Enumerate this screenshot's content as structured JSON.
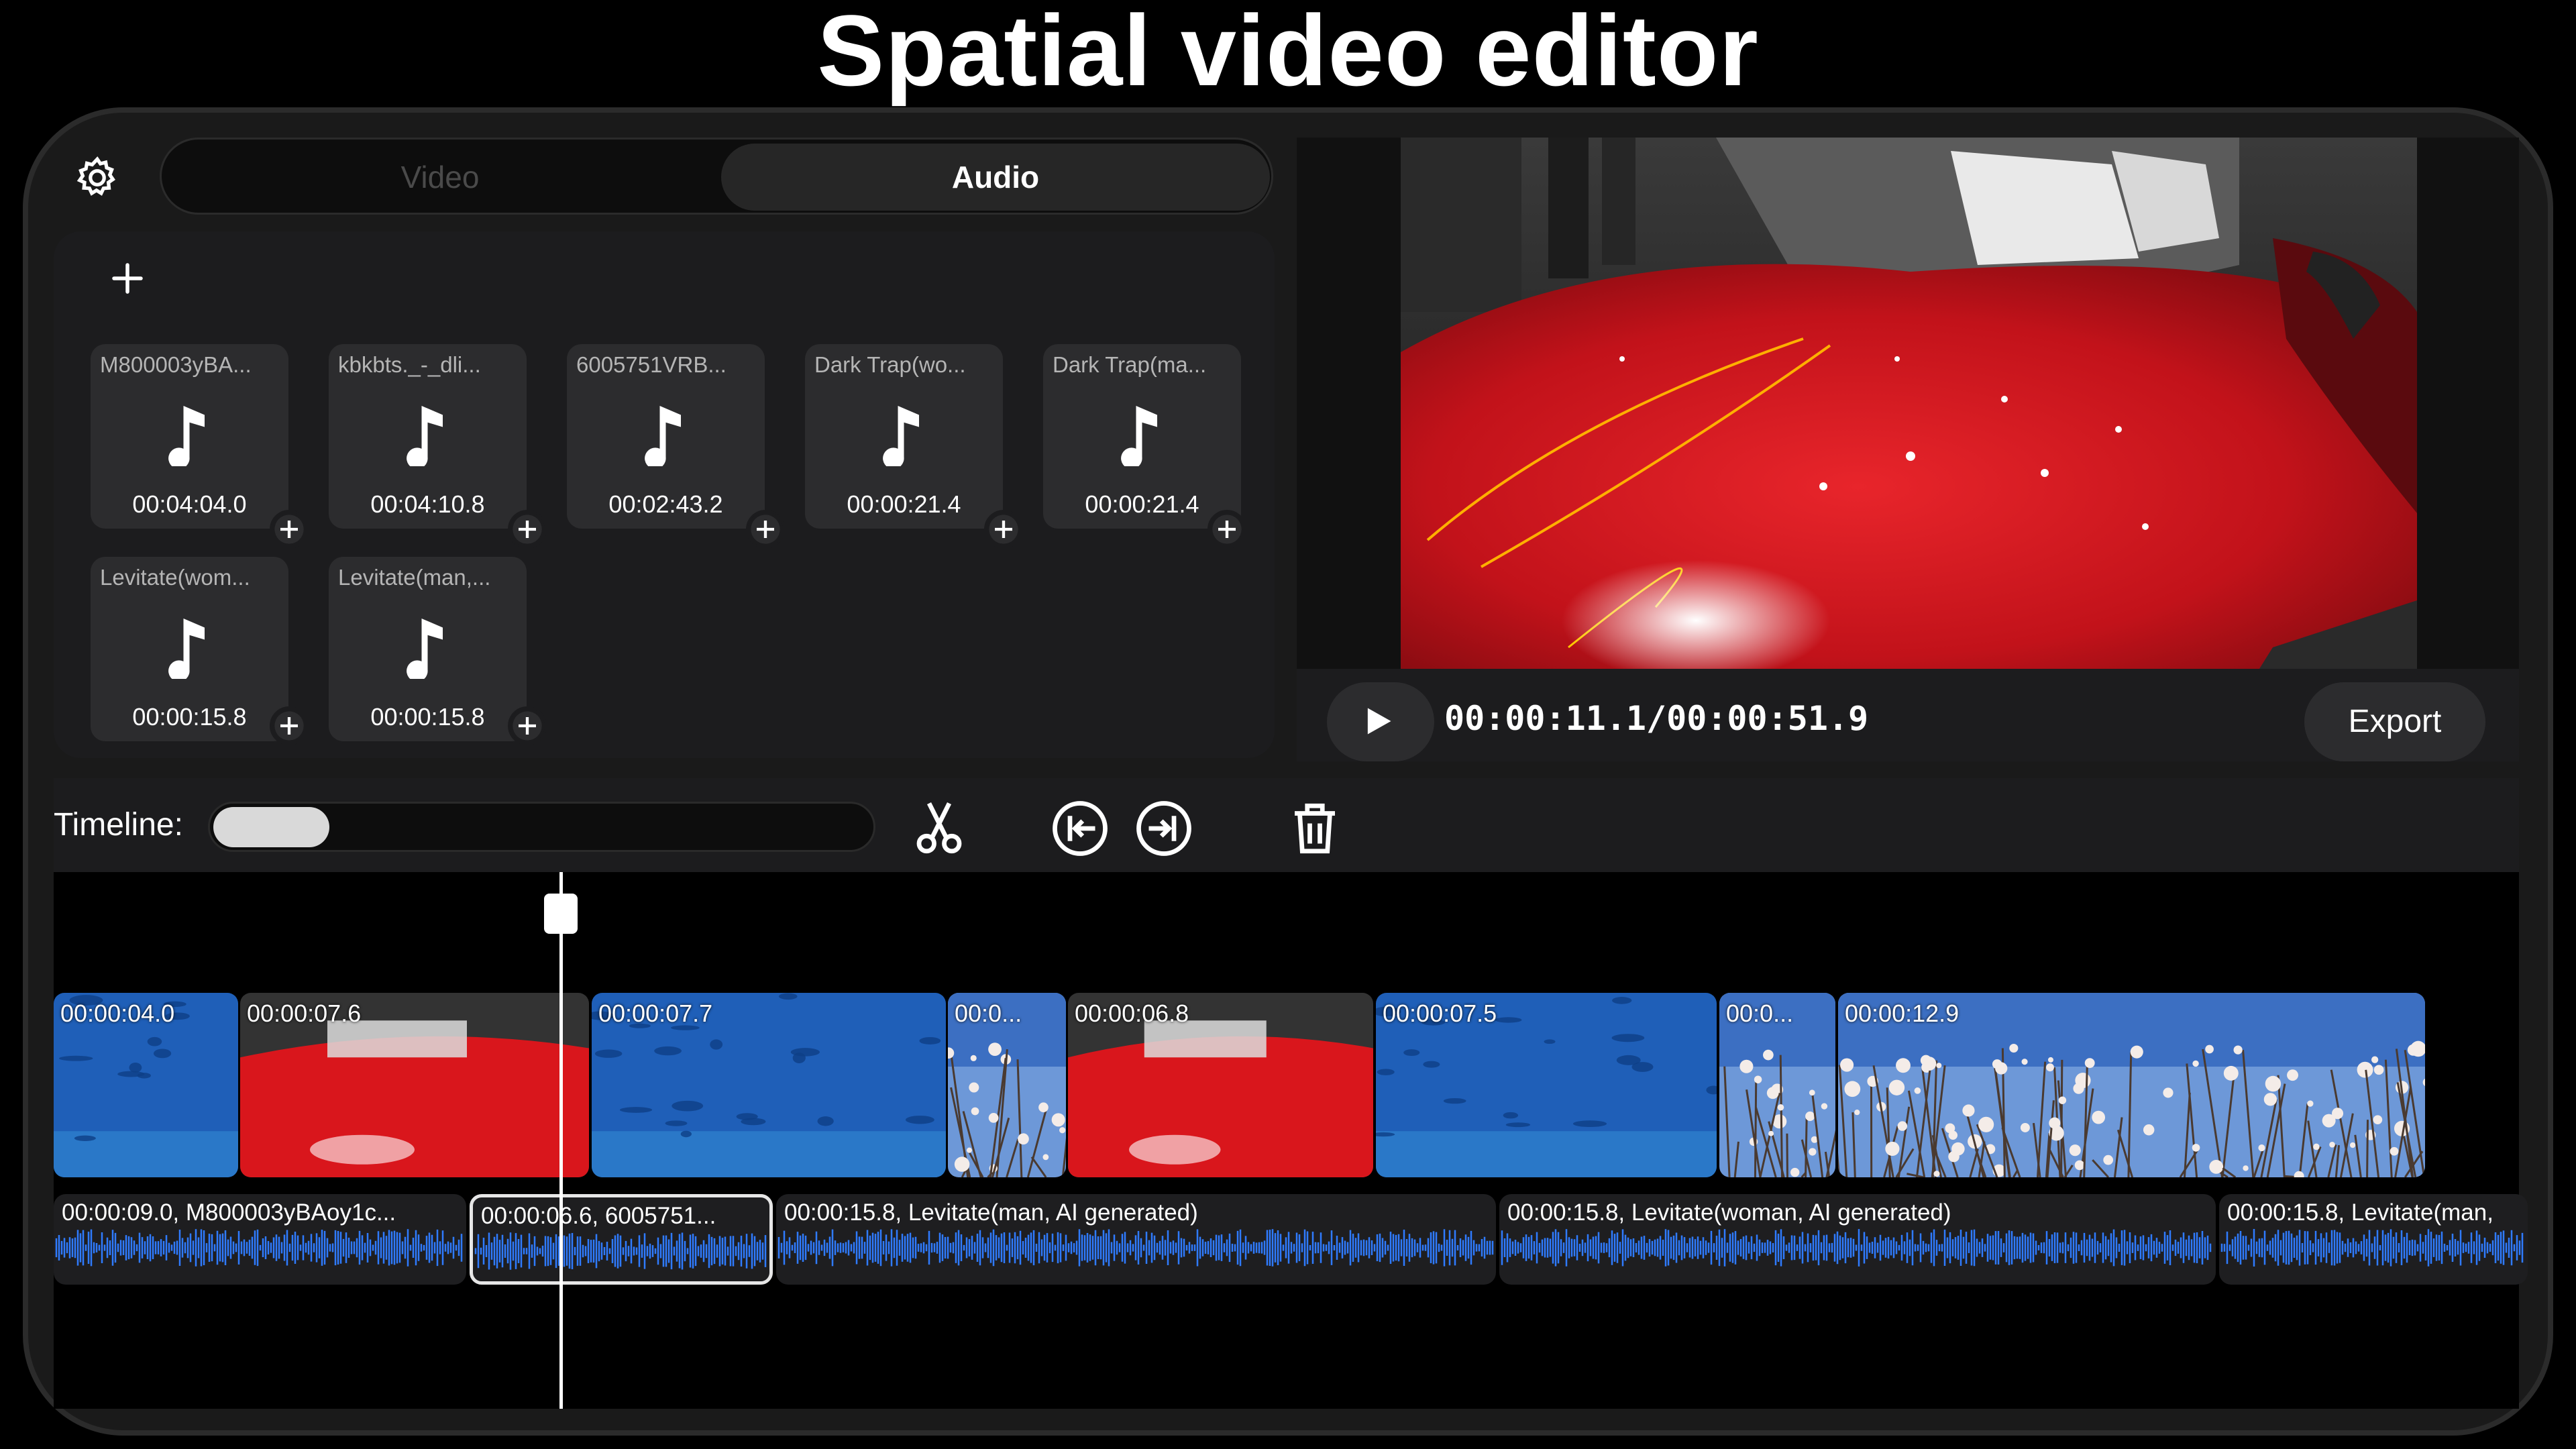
{
  "page_title": "Spatial video editor",
  "tabs": {
    "video": "Video",
    "audio": "Audio"
  },
  "library": {
    "items": [
      {
        "name": "M800003yBA...",
        "duration": "00:04:04.0"
      },
      {
        "name": "kbkbts._-_dli...",
        "duration": "00:04:10.8"
      },
      {
        "name": "6005751VRB...",
        "duration": "00:02:43.2"
      },
      {
        "name": "Dark Trap(wo...",
        "duration": "00:00:21.4"
      },
      {
        "name": "Dark Trap(ma...",
        "duration": "00:00:21.4"
      },
      {
        "name": "Levitate(wom...",
        "duration": "00:00:15.8"
      },
      {
        "name": "Levitate(man,...",
        "duration": "00:00:15.8"
      }
    ]
  },
  "preview": {
    "timecode": "00:00:11.1/00:00:51.9",
    "export_label": "Export"
  },
  "toolbar": {
    "timeline_label": "Timeline:",
    "zoom_fraction": 0.075
  },
  "video_clips": [
    {
      "label": "00:00:04.0",
      "theme": "aquarium"
    },
    {
      "label": "00:00:07.6",
      "theme": "car"
    },
    {
      "label": "00:00:07.7",
      "theme": "aquarium"
    },
    {
      "label": "00:0...",
      "theme": "blossom"
    },
    {
      "label": "00:00:06.8",
      "theme": "car"
    },
    {
      "label": "00:00:07.5",
      "theme": "aquarium"
    },
    {
      "label": "00:0...",
      "theme": "blossom"
    },
    {
      "label": "00:00:12.9",
      "theme": "blossom"
    }
  ],
  "audio_clips": [
    {
      "label": "00:00:09.0, M800003yBAoy1c..."
    },
    {
      "label": "00:00:06.6, 6005751..."
    },
    {
      "label": "00:00:15.8, Levitate(man, AI generated)"
    },
    {
      "label": "00:00:15.8, Levitate(woman, AI generated)"
    },
    {
      "label": "00:00:15.8, Levitate(man,"
    }
  ],
  "colors": {
    "waveform": "#2f7bff",
    "aquarium": "#1f5fb8",
    "car": "#d9161c",
    "blossom": "#6d98d8"
  }
}
